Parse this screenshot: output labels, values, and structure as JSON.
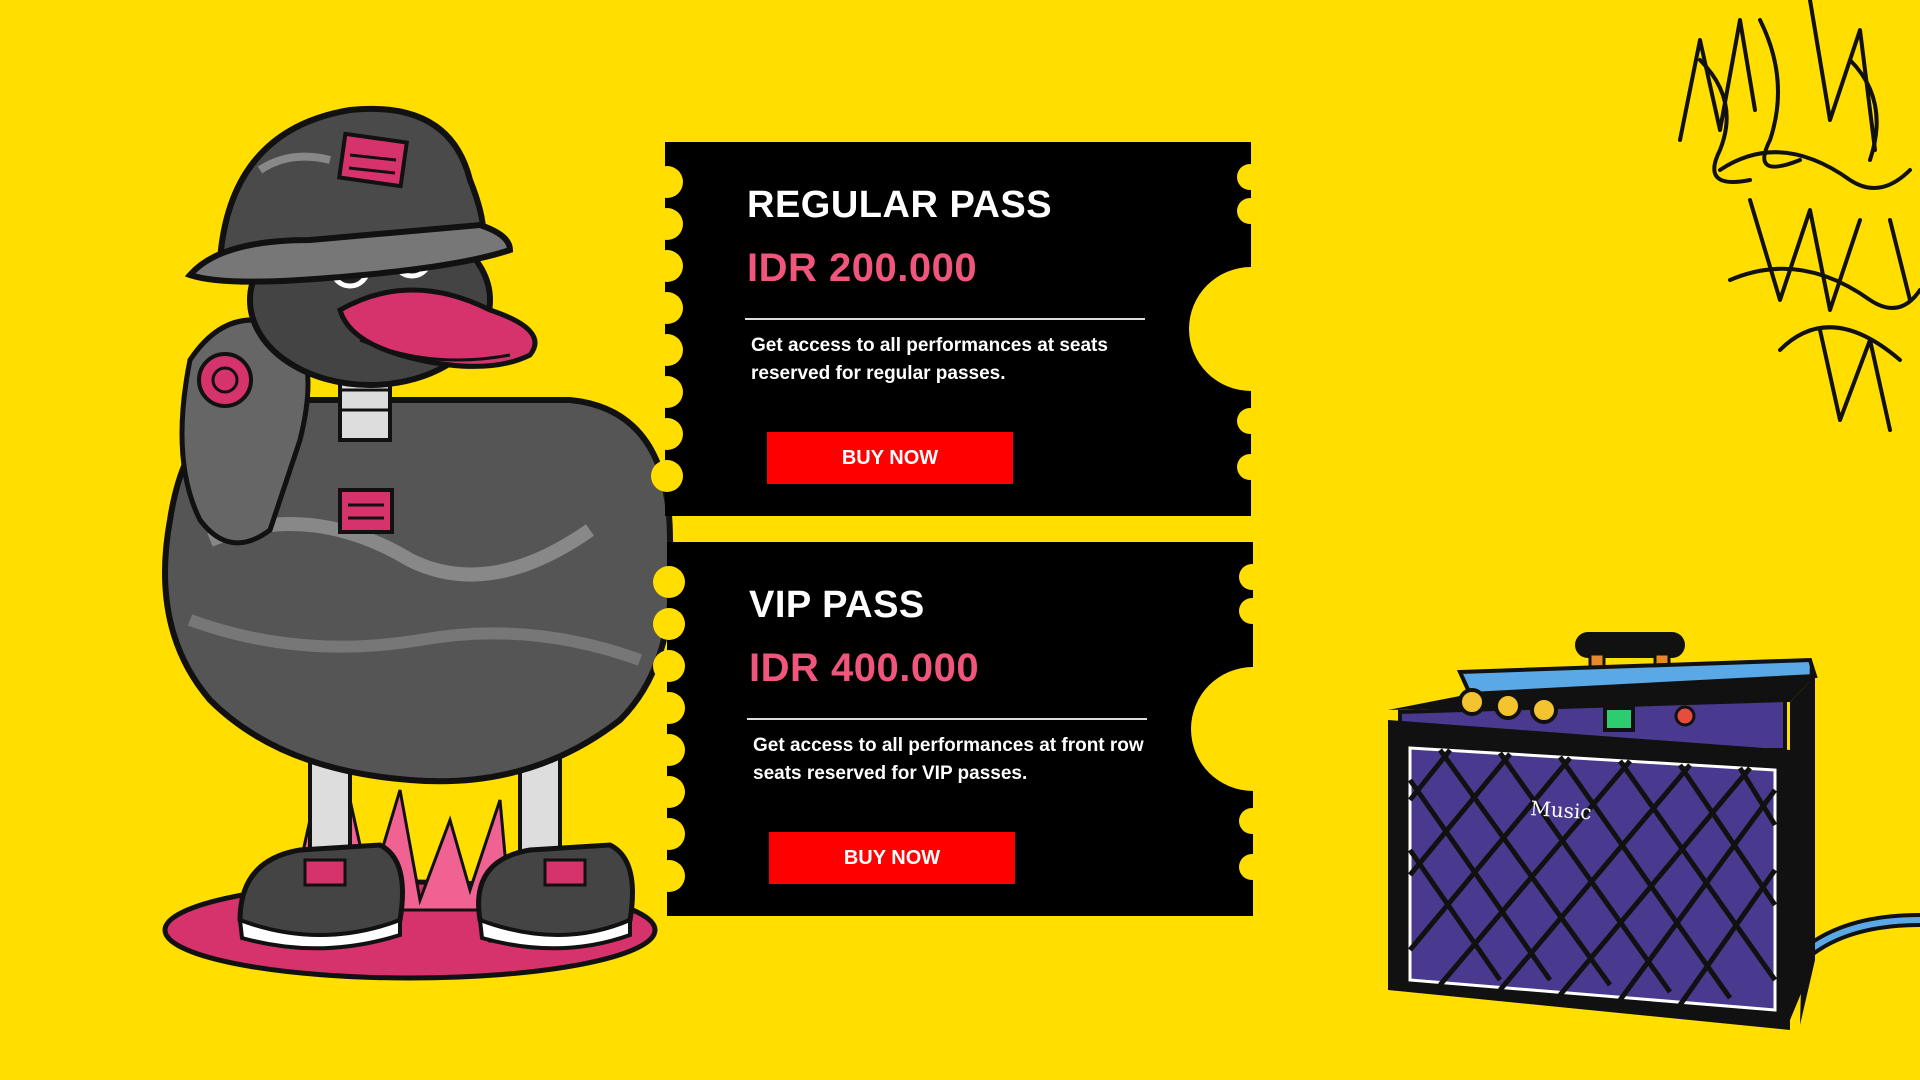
{
  "tickets": [
    {
      "title": "REGULAR PASS",
      "price": "IDR 200.000",
      "description": "Get access to all performances at seats reserved for regular passes.",
      "button_label": "BUY NOW"
    },
    {
      "title": "VIP PASS",
      "price": "IDR 400.000",
      "description": "Get access to all performances at front row seats reserved for VIP passes.",
      "button_label": "BUY NOW"
    }
  ],
  "amplifier": {
    "label": "Music"
  },
  "colors": {
    "background": "#FFDE00",
    "ticket": "#000000",
    "price": "#F0557C",
    "button": "#FF0000",
    "duck_accent": "#D6336C",
    "amp_body": "#4A3A8F"
  },
  "icons": [
    "duck-mascot-illustration",
    "graffiti-tag-decoration",
    "music-amplifier-illustration"
  ]
}
